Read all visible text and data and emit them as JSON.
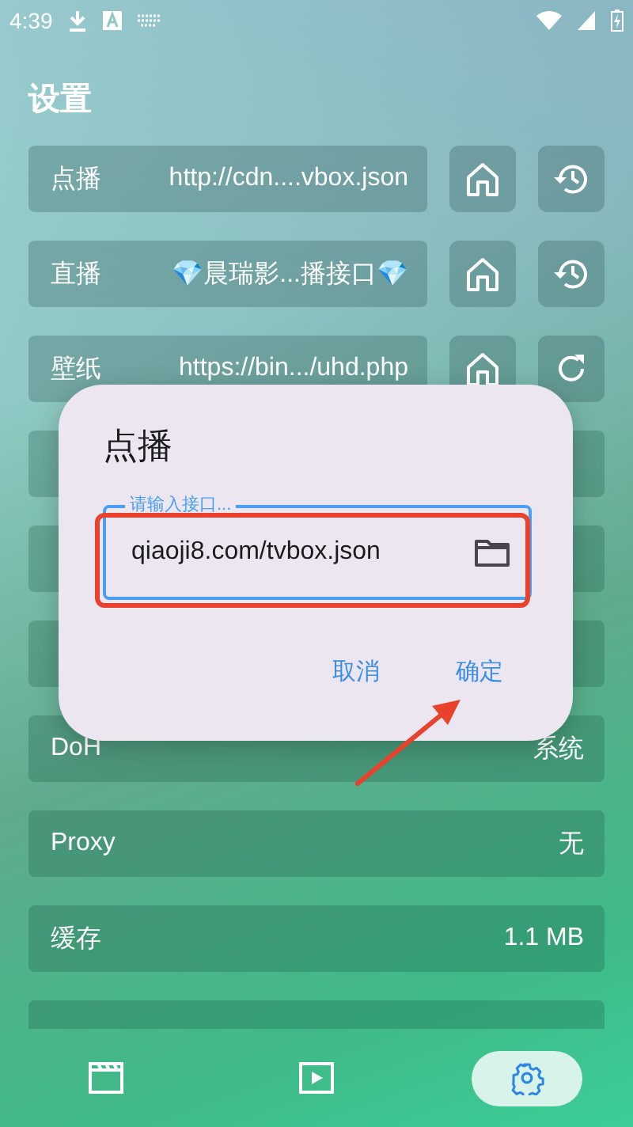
{
  "status_bar": {
    "time": "4:39"
  },
  "title": "设置",
  "source_rows": [
    {
      "label": "点播",
      "value": "http://cdn....vbox.json",
      "actions": [
        {
          "kind": "home"
        },
        {
          "kind": "history"
        }
      ]
    },
    {
      "label": "直播",
      "value": "💎晨瑞影...播接口💎",
      "actions": [
        {
          "kind": "home"
        },
        {
          "kind": "history"
        }
      ]
    },
    {
      "label": "壁纸",
      "value": "https://bin.../uhd.php",
      "actions": [
        {
          "kind": "home"
        },
        {
          "kind": "refresh"
        }
      ]
    }
  ],
  "settings": [
    {
      "label": "DoH",
      "value": "系统"
    },
    {
      "label": "Proxy",
      "value": "无"
    },
    {
      "label": "缓存",
      "value": "1.1 MB"
    }
  ],
  "dialog": {
    "title": "点播",
    "field": {
      "label": "请输入接口...",
      "value": "qiaoji8.com/tvbox.json"
    },
    "buttons": [
      "取消",
      "确定"
    ]
  },
  "nav": [
    {
      "kind": "film",
      "selected": false
    },
    {
      "kind": "play",
      "selected": false
    },
    {
      "kind": "settings",
      "selected": true
    }
  ]
}
